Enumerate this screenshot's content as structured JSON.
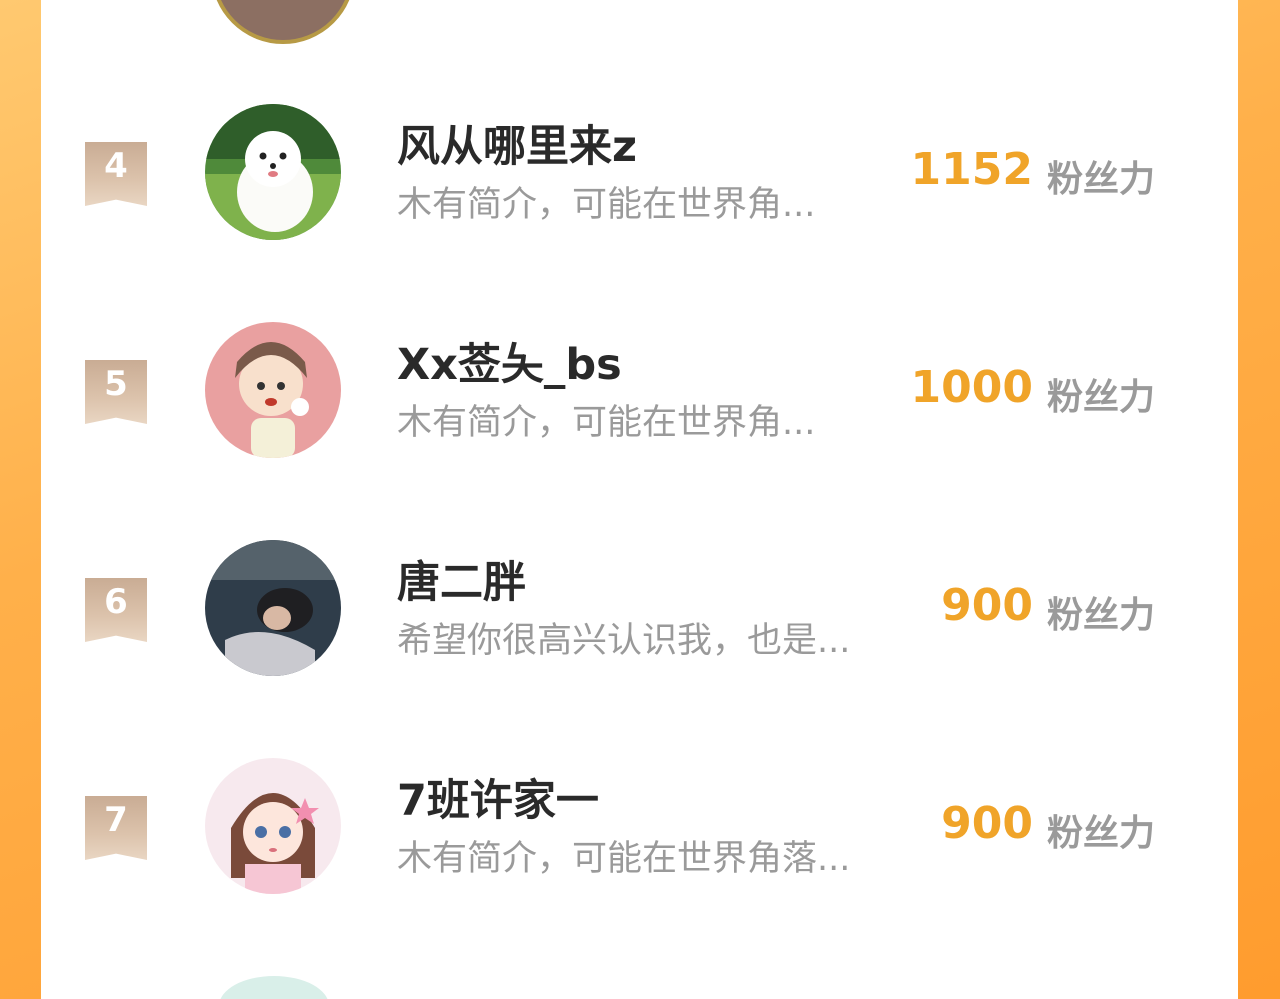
{
  "list": {
    "items": [
      {
        "rank": "4",
        "name": "风从哪里来z",
        "bio": "木有简介，可能在世界角...",
        "score": "1152",
        "unit": "粉丝力",
        "avatar": "white-pomeranian-dog"
      },
      {
        "rank": "5",
        "name": "Xx莶夨_bs",
        "bio": "木有简介，可能在世界角...",
        "score": "1000",
        "unit": "粉丝力",
        "avatar": "cartoon-boy-with-cat"
      },
      {
        "rank": "6",
        "name": "唐二胖",
        "bio": "希望你很高兴认识我，也是...",
        "score": "900",
        "unit": "粉丝力",
        "avatar": "sleeping-girl-photo"
      },
      {
        "rank": "7",
        "name": "7班许家一",
        "bio": "木有简介，可能在世界角落...",
        "score": "900",
        "unit": "粉丝力",
        "avatar": "anime-girl"
      }
    ]
  },
  "colors": {
    "background": "#ffb04a",
    "score": "#f0a429",
    "rank_badge": "#d4b9a1"
  }
}
